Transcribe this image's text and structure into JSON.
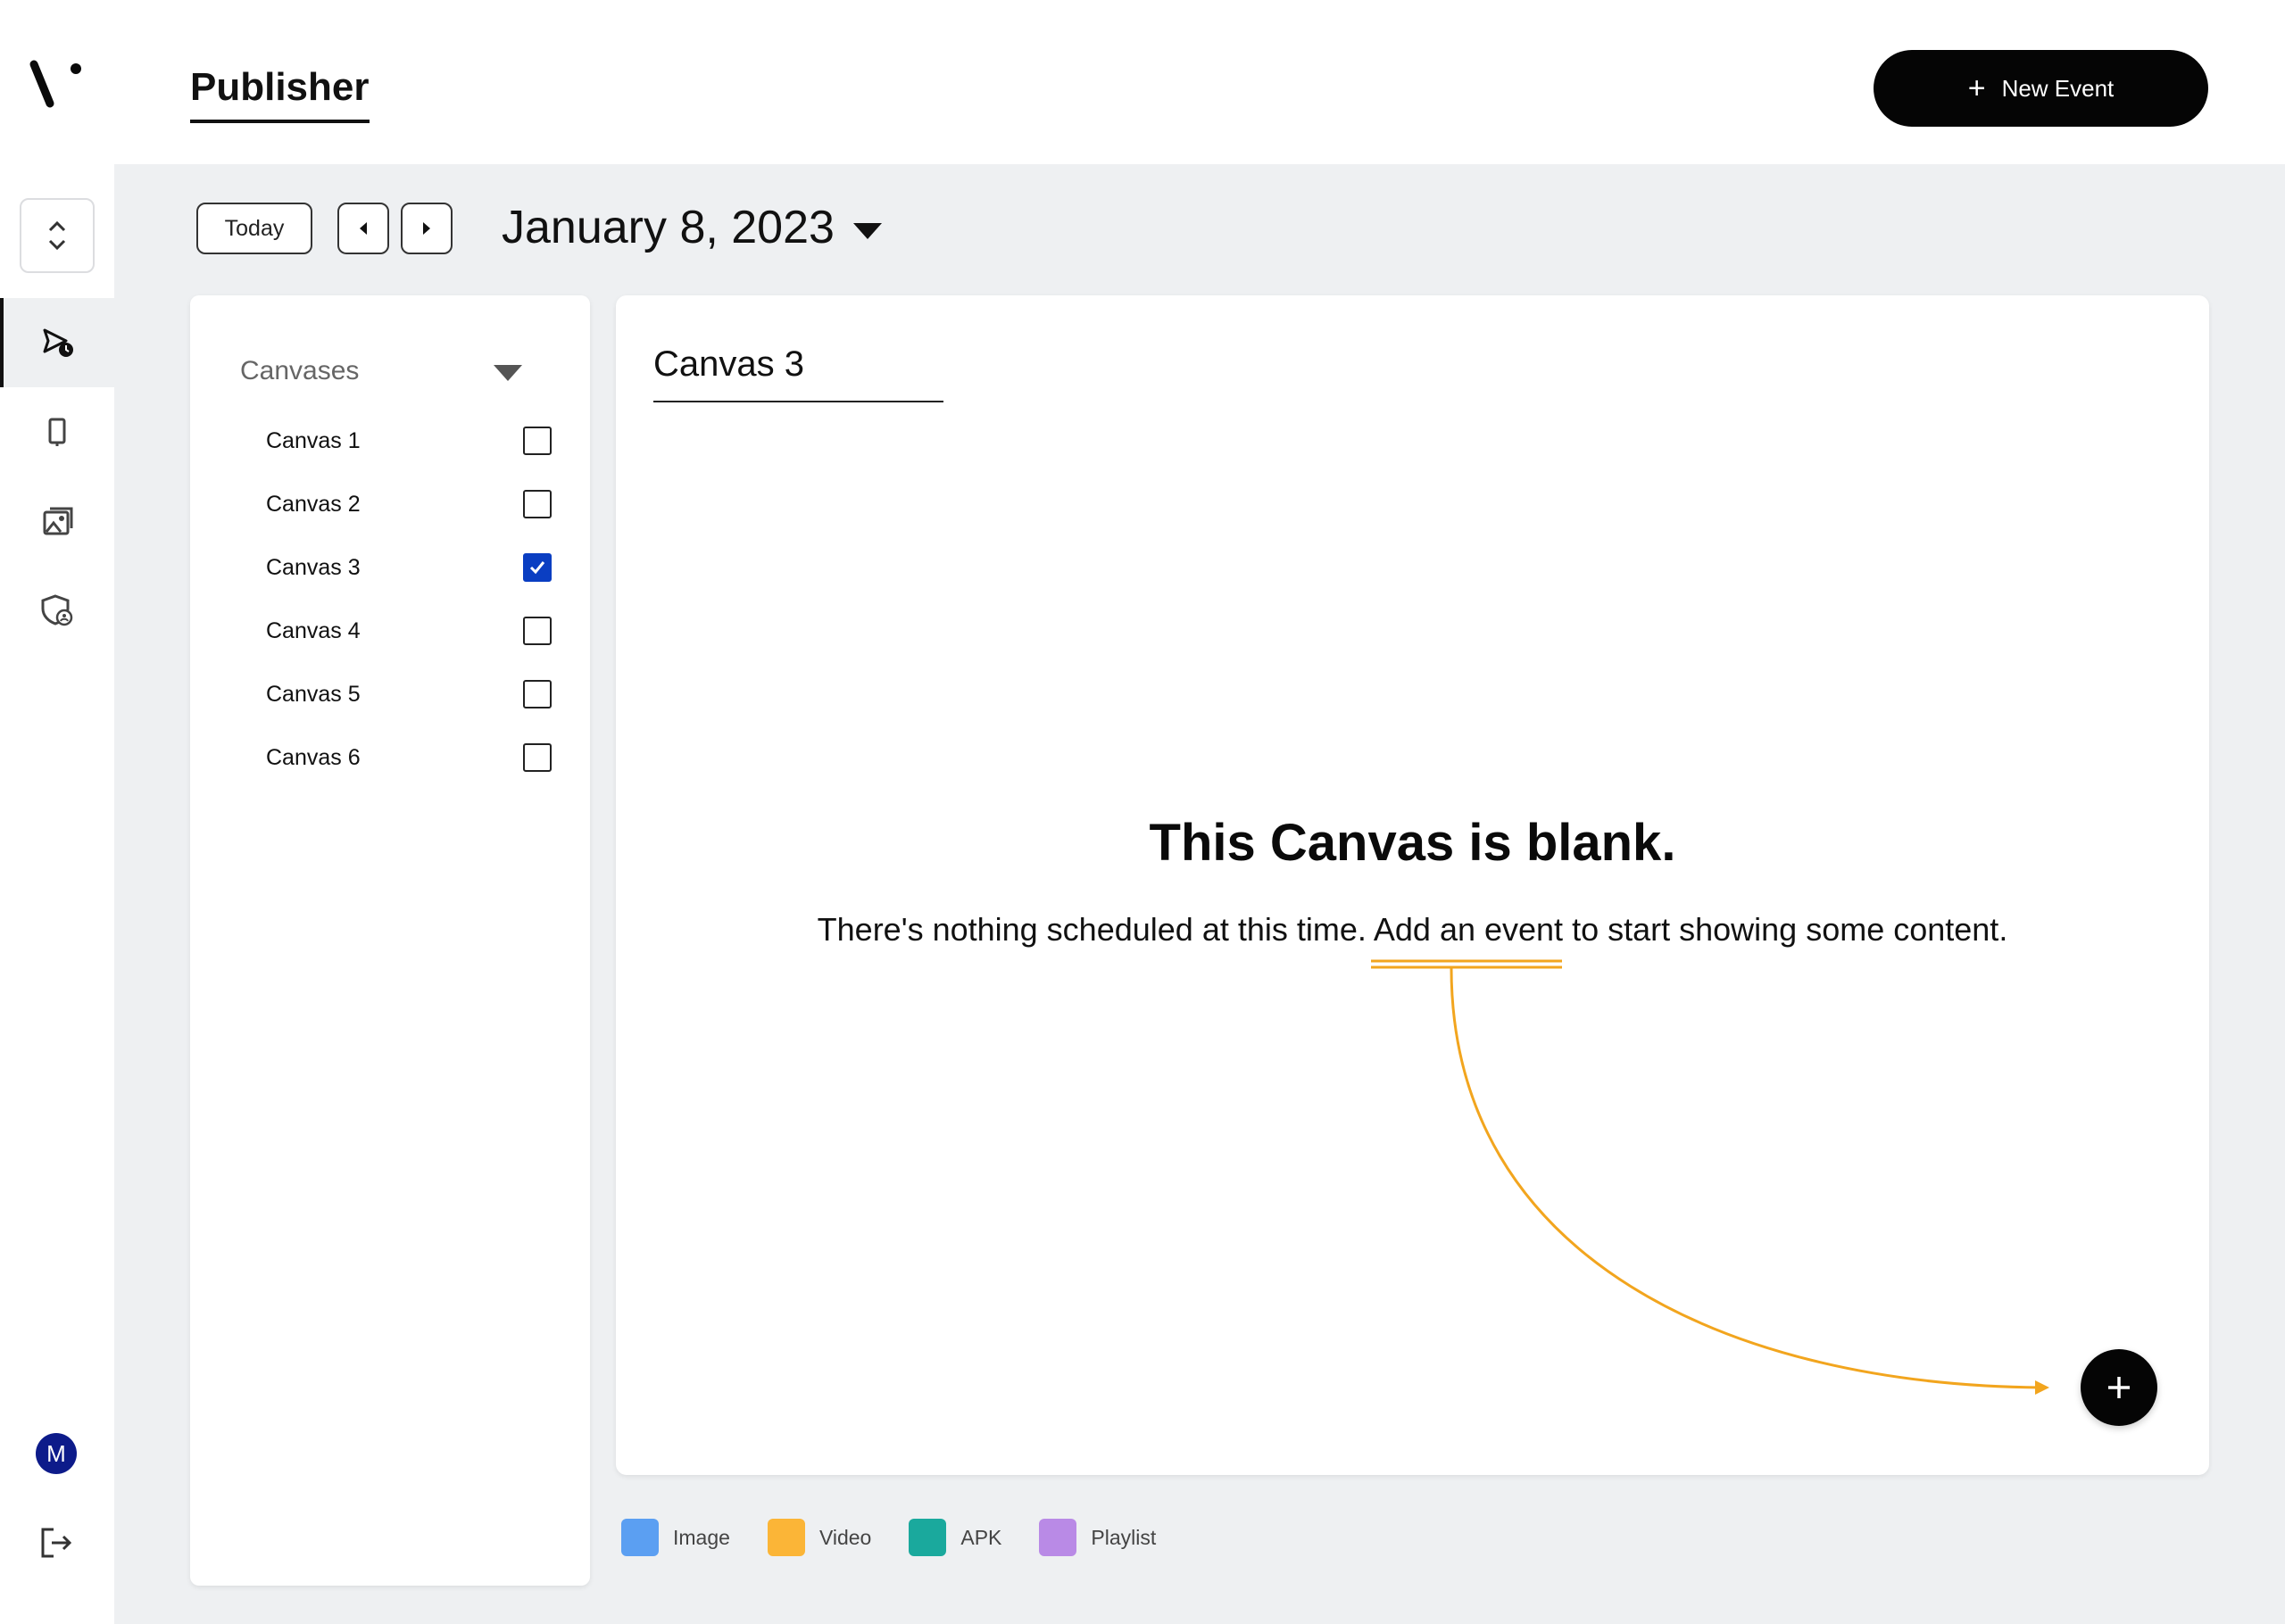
{
  "header": {
    "title": "Publisher",
    "new_event_label": "New Event"
  },
  "nav": {
    "items": [
      {
        "name": "publisher",
        "icon": "schedule-send-icon",
        "active": true
      },
      {
        "name": "devices",
        "icon": "device-icon",
        "active": false
      },
      {
        "name": "media",
        "icon": "media-library-icon",
        "active": false
      },
      {
        "name": "admin",
        "icon": "admin-shield-icon",
        "active": false
      }
    ],
    "avatar_initial": "M"
  },
  "toolbar": {
    "today_label": "Today",
    "date": "January 8, 2023"
  },
  "canvases": {
    "header": "Canvases",
    "items": [
      {
        "label": "Canvas 1",
        "checked": false
      },
      {
        "label": "Canvas 2",
        "checked": false
      },
      {
        "label": "Canvas 3",
        "checked": true
      },
      {
        "label": "Canvas 4",
        "checked": false
      },
      {
        "label": "Canvas 5",
        "checked": false
      },
      {
        "label": "Canvas 6",
        "checked": false
      }
    ]
  },
  "main": {
    "canvas_title": "Canvas 3",
    "blank_heading": "This Canvas is blank.",
    "blank_text_before": "There's nothing scheduled at this time. ",
    "blank_text_link": "Add an event",
    "blank_text_after": " to start showing some content."
  },
  "legend": {
    "items": [
      {
        "label": "Image",
        "color": "#5b9ff2"
      },
      {
        "label": "Video",
        "color": "#fbb537"
      },
      {
        "label": "APK",
        "color": "#1aa99d"
      },
      {
        "label": "Playlist",
        "color": "#b98ae6"
      }
    ]
  },
  "colors": {
    "accent": "#0a3ec2",
    "annotation": "#f2a51e"
  }
}
